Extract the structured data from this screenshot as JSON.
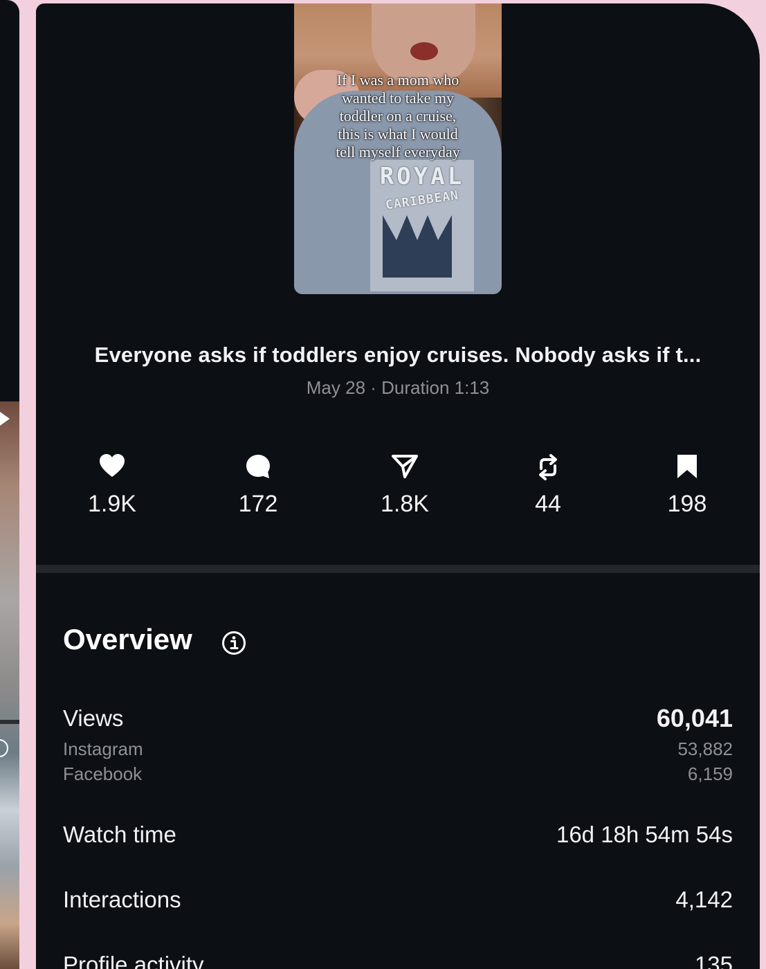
{
  "thumbnail": {
    "overlay_text": "If I was a mom who\nwanted to take my\ntoddler on a cruise,\nthis is what I would\ntell myself everyday",
    "shirt_brand_top": "ROYAL",
    "shirt_brand_bottom": "CARIBBEAN"
  },
  "post": {
    "title": "Everyone asks if toddlers enjoy cruises. Nobody asks if t...",
    "meta": "May 28 · Duration 1:13"
  },
  "engagement": [
    {
      "icon": "heart-icon",
      "value": "1.9K"
    },
    {
      "icon": "comment-icon",
      "value": "172"
    },
    {
      "icon": "share-icon",
      "value": "1.8K"
    },
    {
      "icon": "repost-icon",
      "value": "44"
    },
    {
      "icon": "bookmark-icon",
      "value": "198"
    }
  ],
  "overview": {
    "title": "Overview",
    "views": {
      "label": "Views",
      "value": "60,041",
      "breakdown": [
        {
          "label": "Instagram",
          "value": "53,882"
        },
        {
          "label": "Facebook",
          "value": "6,159"
        }
      ]
    },
    "watch_time": {
      "label": "Watch time",
      "value": "16d 18h 54m 54s"
    },
    "interactions": {
      "label": "Interactions",
      "value": "4,142"
    },
    "profile_activity": {
      "label": "Profile activity",
      "value": "135"
    }
  },
  "colors": {
    "page_background": "#f3d0de",
    "card_background": "#0c0f14",
    "muted_text": "#8e9096"
  }
}
